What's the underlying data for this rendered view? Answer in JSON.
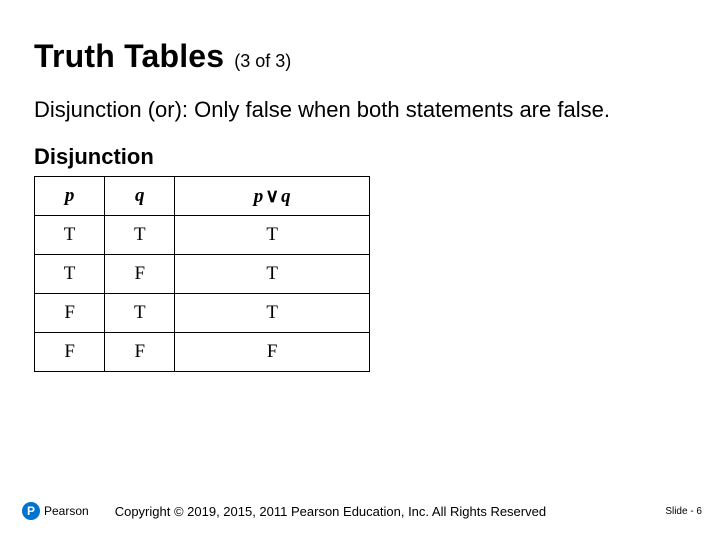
{
  "title": {
    "main": "Truth Tables",
    "sub": "(3 of 3)"
  },
  "body": "Disjunction (or): Only false when both statements are false.",
  "subhead": "Disjunction",
  "table": {
    "headers": {
      "p": "p",
      "q": "q",
      "pq_p": "p",
      "pq_sym": "∨",
      "pq_q": "q"
    },
    "rows": [
      {
        "p": "T",
        "q": "T",
        "r": "T"
      },
      {
        "p": "T",
        "q": "F",
        "r": "T"
      },
      {
        "p": "F",
        "q": "T",
        "r": "T"
      },
      {
        "p": "F",
        "q": "F",
        "r": "F"
      }
    ]
  },
  "footer": {
    "logo_letter": "P",
    "logo_text": "Pearson",
    "copyright": "Copyright © 2019, 2015, 2011 Pearson Education, Inc. All Rights Reserved",
    "slide": "Slide - 6"
  }
}
